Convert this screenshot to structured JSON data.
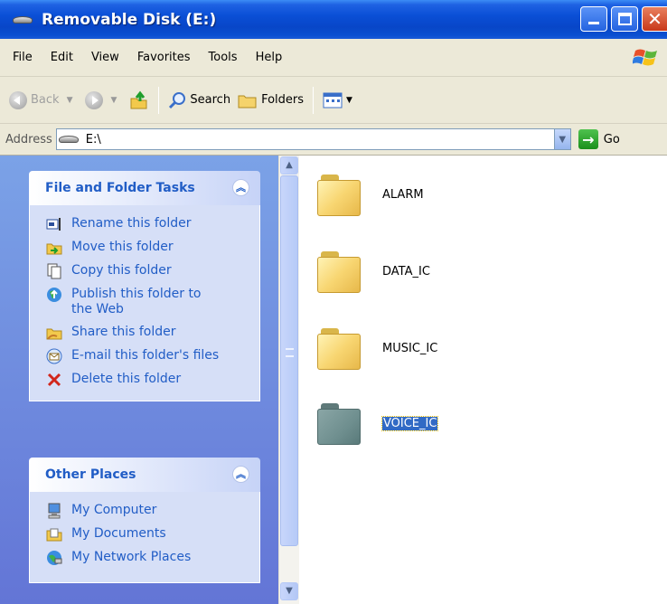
{
  "window": {
    "title": "Removable Disk (E:)"
  },
  "menu": [
    "File",
    "Edit",
    "View",
    "Favorites",
    "Tools",
    "Help"
  ],
  "toolbar": {
    "back": "Back",
    "search": "Search",
    "folders": "Folders"
  },
  "address": {
    "label": "Address",
    "value": "E:\\",
    "go": "Go"
  },
  "tasks_panel": {
    "title": "File and Folder Tasks",
    "items": [
      {
        "label": "Rename this folder",
        "icon": "rename-icon"
      },
      {
        "label": "Move this folder",
        "icon": "move-icon"
      },
      {
        "label": "Copy this folder",
        "icon": "copy-icon"
      },
      {
        "label": "Publish this folder to the Web",
        "icon": "publish-web-icon"
      },
      {
        "label": "Share this folder",
        "icon": "share-icon"
      },
      {
        "label": "E-mail this folder's files",
        "icon": "email-icon"
      },
      {
        "label": "Delete this folder",
        "icon": "delete-icon"
      }
    ]
  },
  "places_panel": {
    "title": "Other Places",
    "items": [
      {
        "label": "My Computer",
        "icon": "my-computer-icon"
      },
      {
        "label": "My Documents",
        "icon": "my-documents-icon"
      },
      {
        "label": "My Network Places",
        "icon": "network-places-icon"
      }
    ]
  },
  "files": [
    {
      "name": "ALARM",
      "selected": false
    },
    {
      "name": "DATA_IC",
      "selected": false
    },
    {
      "name": "MUSIC_IC",
      "selected": false
    },
    {
      "name": "VOICE_IC",
      "selected": true
    }
  ]
}
